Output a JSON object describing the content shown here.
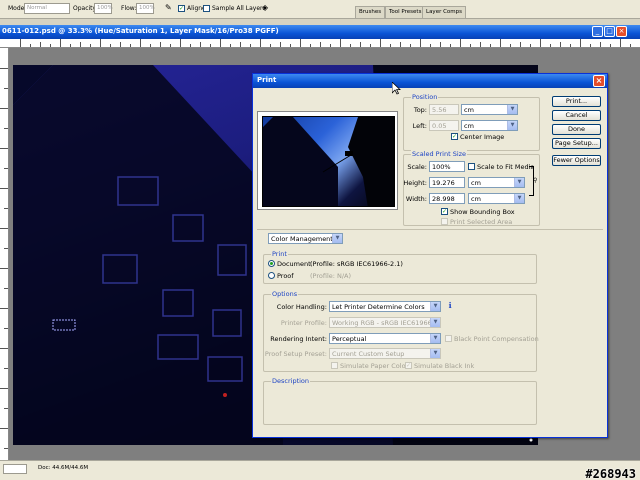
{
  "options_bar": {
    "mode_label": "Mode:",
    "mode_value": "Normal",
    "opacity_label": "Opacity:",
    "opacity_value": "100%",
    "flow_label": "Flow:",
    "flow_value": "100%",
    "aligned_label": "Aligned",
    "aligned_checked": true,
    "sample_all_label": "Sample All Layers",
    "palette_tabs": [
      "Brushes",
      "Tool Presets",
      "Layer Comps"
    ]
  },
  "document": {
    "title": "0611-012.psd @ 33.3% (Hue/Saturation 1, Layer Mask/16/Pro38 PGFF)",
    "status_doc": "Doc: 44.6M/44.6M"
  },
  "watermark": "#268943",
  "print_dialog": {
    "title": "Print",
    "close_glyph": "×",
    "buttons": {
      "print": "Print...",
      "cancel": "Cancel",
      "done": "Done",
      "page_setup": "Page Setup...",
      "fewer_options": "Fewer Options"
    },
    "position": {
      "group_label": "Position",
      "top_label": "Top:",
      "top_value": "5.56",
      "top_unit": "cm",
      "left_label": "Left:",
      "left_value": "0.05",
      "left_unit": "cm",
      "center_image_label": "Center Image",
      "center_image_checked": true
    },
    "scaled_print_size": {
      "group_label": "Scaled Print Size",
      "scale_label": "Scale:",
      "scale_value": "100%",
      "scale_to_fit_label": "Scale to Fit Media",
      "height_label": "Height:",
      "height_value": "19.276",
      "height_unit": "cm",
      "width_label": "Width:",
      "width_value": "28.998",
      "width_unit": "cm",
      "show_bounding_box_label": "Show Bounding Box",
      "show_bounding_box_checked": true,
      "print_selected_area_label": "Print Selected Area"
    },
    "color_management_dropdown": "Color Management",
    "print_group": {
      "group_label": "Print",
      "document_label": "Document",
      "document_profile": "(Profile: sRGB IEC61966-2.1)",
      "proof_label": "Proof",
      "proof_profile": "(Profile: N/A)",
      "selected": "Document"
    },
    "options": {
      "group_label": "Options",
      "color_handling_label": "Color Handling:",
      "color_handling_value": "Let Printer Determine Colors",
      "printer_profile_label": "Printer Profile:",
      "printer_profile_value": "Working RGB - sRGB IEC61966-2.1",
      "rendering_intent_label": "Rendering Intent:",
      "rendering_intent_value": "Perceptual",
      "black_point_label": "Black Point Compensation",
      "proof_setup_label": "Proof Setup Preset:",
      "proof_setup_value": "Current Custom Setup",
      "simulate_paper_label": "Simulate Paper Color",
      "simulate_black_label": "Simulate Black Ink"
    },
    "description": {
      "group_label": "Description"
    }
  }
}
